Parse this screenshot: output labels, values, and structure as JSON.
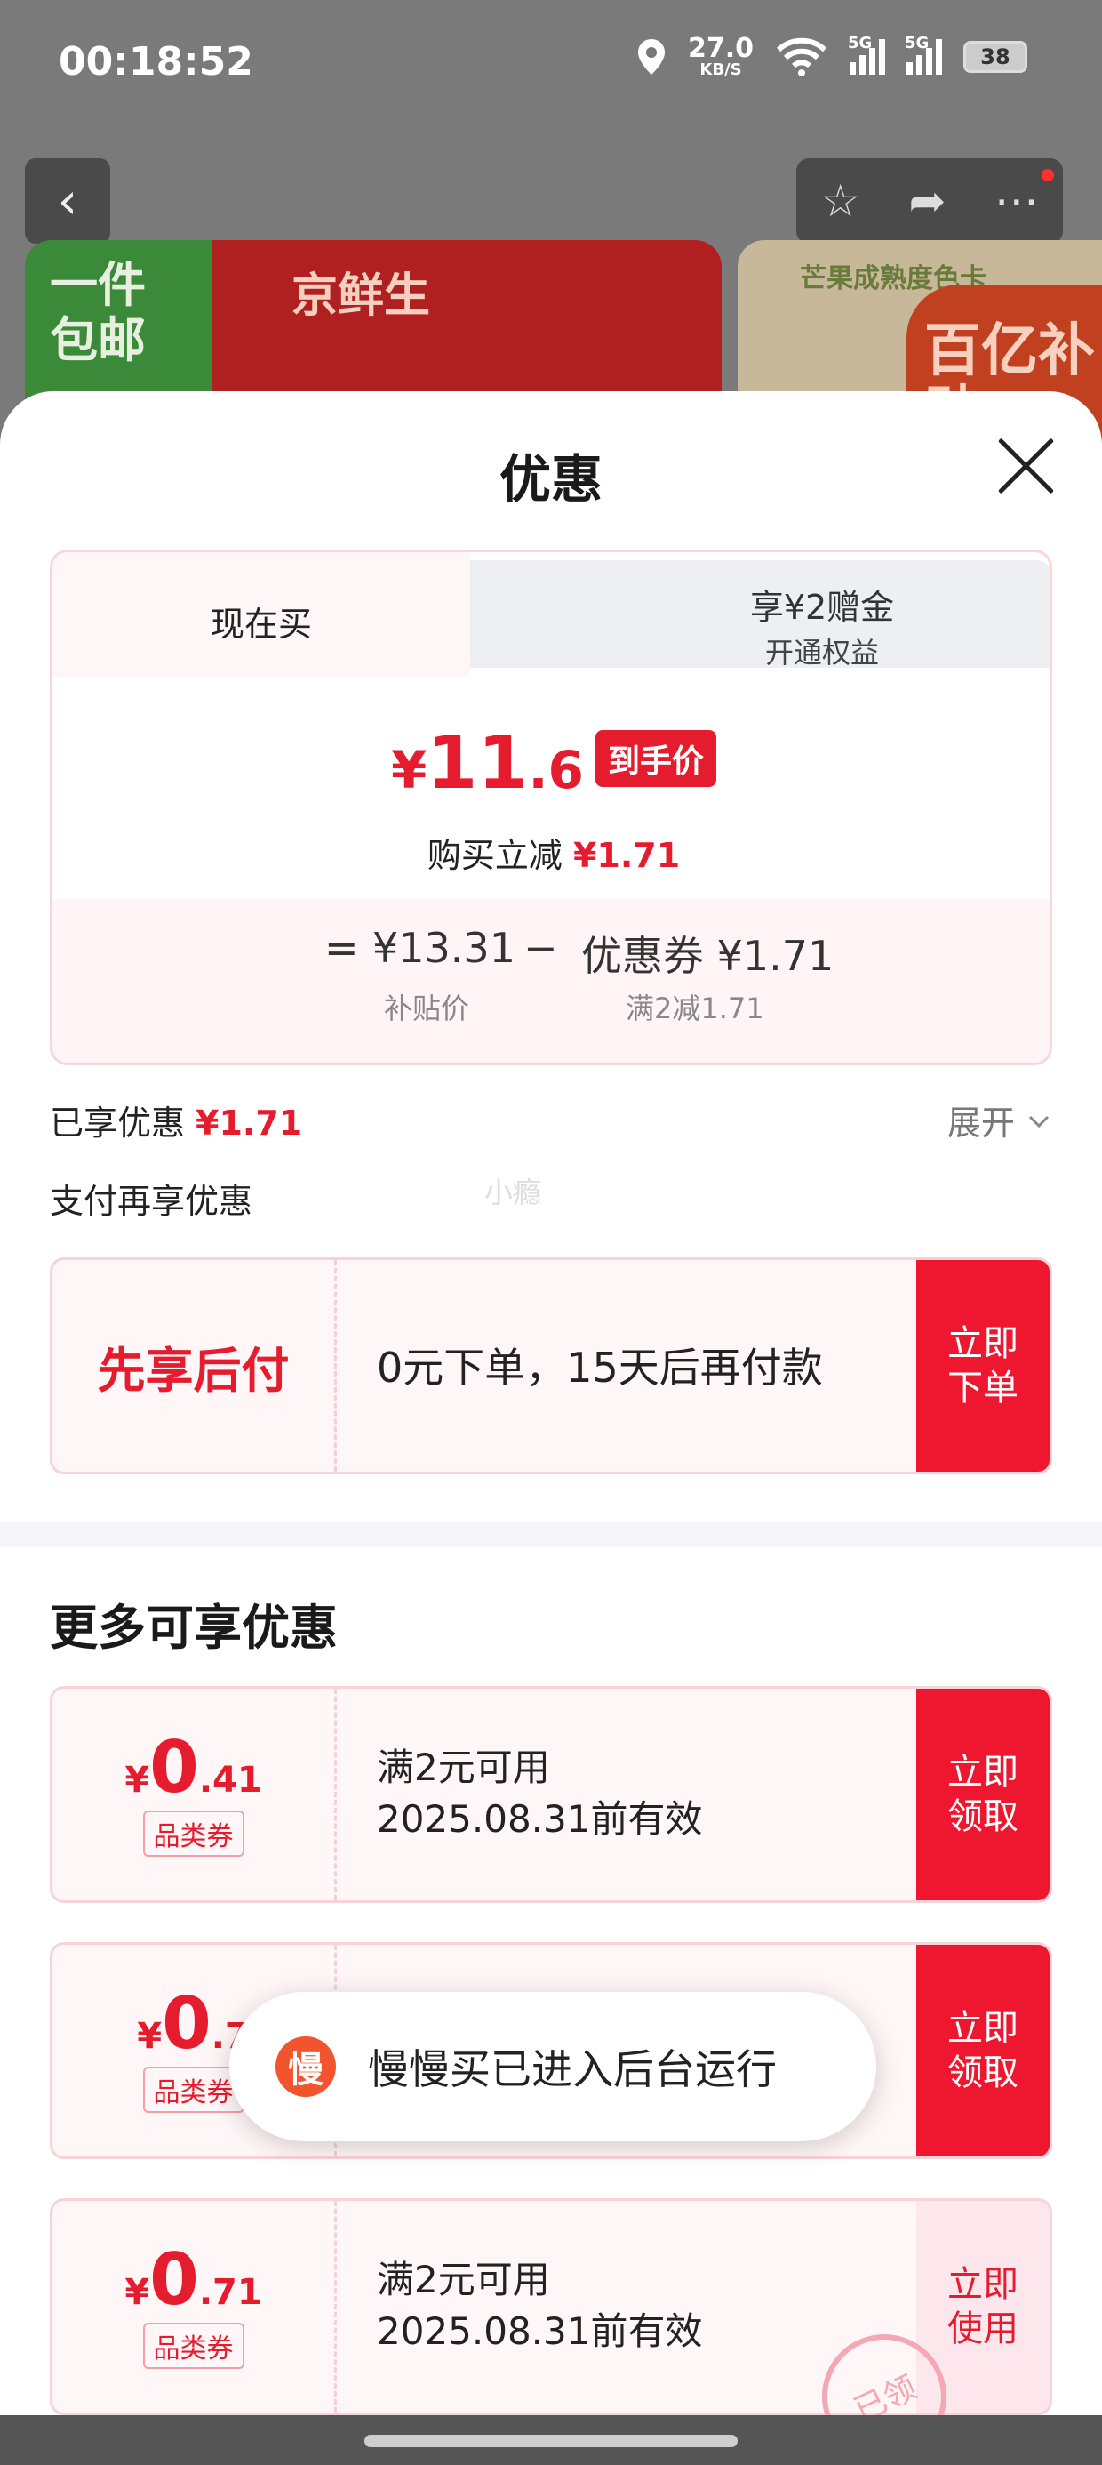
{
  "status": {
    "time": "00:18:52",
    "net_speed": "27.0",
    "net_unit": "KB/S",
    "sig1": "5G",
    "sig2": "5G",
    "battery": "38"
  },
  "background": {
    "banner1_badge": "一件包邮",
    "banner1_title": "京鲜生",
    "banner2_title": "芒果成熟度色卡",
    "banner2_badge": "百亿补贴"
  },
  "sheet": {
    "title": "优惠"
  },
  "card": {
    "tab_now": "现在买",
    "tab_alt_line1": "享¥2赠金",
    "tab_alt_line2": "开通权益",
    "price_symbol": "¥",
    "price_int": "11",
    "price_dec": ".6",
    "price_tag": "到手价",
    "instant_label": "购买立减",
    "instant_value": "¥1.71",
    "eq_sign": "=",
    "base_price": "¥13.31",
    "minus_sign": "−",
    "coupon_part": "优惠券 ¥1.71",
    "base_label": "补贴价",
    "coupon_rule": "满2减1.71"
  },
  "enjoyed": {
    "label": "已享优惠",
    "value": "¥1.71",
    "expand": "展开"
  },
  "pay": {
    "label": "支付再享优惠",
    "watermark": "小瘾"
  },
  "bnpl": {
    "title": "先享后付",
    "desc": "0元下单，15天后再付款",
    "btn": "立即\n下单"
  },
  "more": {
    "title": "更多可享优惠"
  },
  "coupons": [
    {
      "yen": "¥",
      "int": "0",
      "dec": ".41",
      "cat": "品类券",
      "line1": "满2元可用",
      "line2": "2025.08.31前有效",
      "btn": "立即\n领取"
    },
    {
      "yen": "¥",
      "int": "0",
      "dec": ".7",
      "cat": "品类券",
      "btn": "立即\n领取"
    },
    {
      "yen": "¥",
      "int": "0",
      "dec": ".71",
      "cat": "品类券",
      "line1": "满2元可用",
      "line2": "2025.08.31前有效",
      "btn": "立即\n使用",
      "stamp": "已领"
    }
  ],
  "toast": {
    "icon": "慢",
    "text": "慢慢买已进入后台运行"
  }
}
